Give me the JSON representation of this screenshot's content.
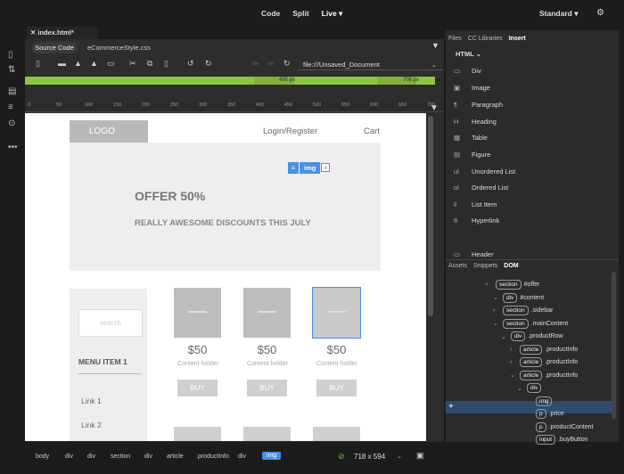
{
  "top": {
    "modes": [
      "Code",
      "Split",
      "Live ▾"
    ],
    "workspace": "Standard ▾",
    "settings_icon": "gear-icon"
  },
  "doc": {
    "tab": "index.html*",
    "source_code": "Source Code",
    "related_file": "eCommerceStyle.css",
    "url": "file:///Unsaved_Document"
  },
  "green_ruler": {
    "left_label": "495 px",
    "right_label": "706 px"
  },
  "ruler_ticks": [
    "0",
    "50",
    "100",
    "150",
    "200",
    "250",
    "300",
    "350",
    "400",
    "450",
    "500",
    "550",
    "600",
    "650",
    "700"
  ],
  "canvas": {
    "logo": "LOGO",
    "nav_login": "Login/Register",
    "nav_cart": "Cart",
    "offer_title": "OFFER 50%",
    "offer_sub": "REALLY AWESOME DISCOUNTS THIS JULY",
    "search": "search",
    "menu_item": "MENU ITEM 1",
    "link1": "Link 1",
    "link2": "Link 2",
    "products": [
      {
        "price": "$50",
        "holder": "Content holder",
        "buy": "BUY"
      },
      {
        "price": "$50",
        "holder": "Content holder",
        "buy": "BUY"
      },
      {
        "price": "$50",
        "holder": "Content holder",
        "buy": "BUY"
      }
    ],
    "selected_tag": "img"
  },
  "status": {
    "crumbs": [
      "body",
      "div",
      "div",
      "section",
      "div",
      "article",
      ".productInfo",
      "div",
      "img"
    ],
    "size": "718 x 594"
  },
  "right": {
    "tabs": [
      "Files",
      "CC Libraries",
      "Insert"
    ],
    "html_selector": "HTML",
    "insert_items": [
      {
        "icon": "div-icon",
        "glyph": "▭",
        "label": "Div"
      },
      {
        "icon": "image-icon",
        "glyph": "▣",
        "label": "Image"
      },
      {
        "icon": "paragraph-icon",
        "glyph": "¶",
        "label": "Paragraph"
      },
      {
        "icon": "heading-icon",
        "glyph": "H",
        "label": "Heading"
      },
      {
        "icon": "table-icon",
        "glyph": "▦",
        "label": "Table"
      },
      {
        "icon": "figure-icon",
        "glyph": "▤",
        "label": "Figure"
      },
      {
        "icon": "unordered-list-icon",
        "glyph": "ul",
        "label": "Unordered List"
      },
      {
        "icon": "ordered-list-icon",
        "glyph": "ol",
        "label": "Ordered List"
      },
      {
        "icon": "list-item-icon",
        "glyph": "li",
        "label": "List Item"
      },
      {
        "icon": "hyperlink-icon",
        "glyph": "8",
        "label": "Hyperlink"
      },
      {
        "icon": "header-icon",
        "glyph": "▭",
        "label": "Header"
      }
    ],
    "dom_tabs": [
      "Assets",
      "Snippets",
      "DOM"
    ],
    "dom_rows": [
      {
        "tag": "section",
        "text": "#offer"
      },
      {
        "tag": "div",
        "text": "#content"
      },
      {
        "tag": "section",
        "text": ".sidebar"
      },
      {
        "tag": "section",
        "text": ".mainContent"
      },
      {
        "tag": "div",
        "text": ".productRow"
      },
      {
        "tag": "article",
        "text": ".productInfo"
      },
      {
        "tag": "article",
        "text": ".productInfo"
      },
      {
        "tag": "article",
        "text": ".productInfo"
      },
      {
        "tag": "div",
        "text": ""
      },
      {
        "tag": "img",
        "text": ""
      },
      {
        "tag": "p",
        "text": ".price"
      },
      {
        "tag": "p",
        "text": ".productContent"
      },
      {
        "tag": "input",
        "text": ".buyButton"
      }
    ]
  }
}
